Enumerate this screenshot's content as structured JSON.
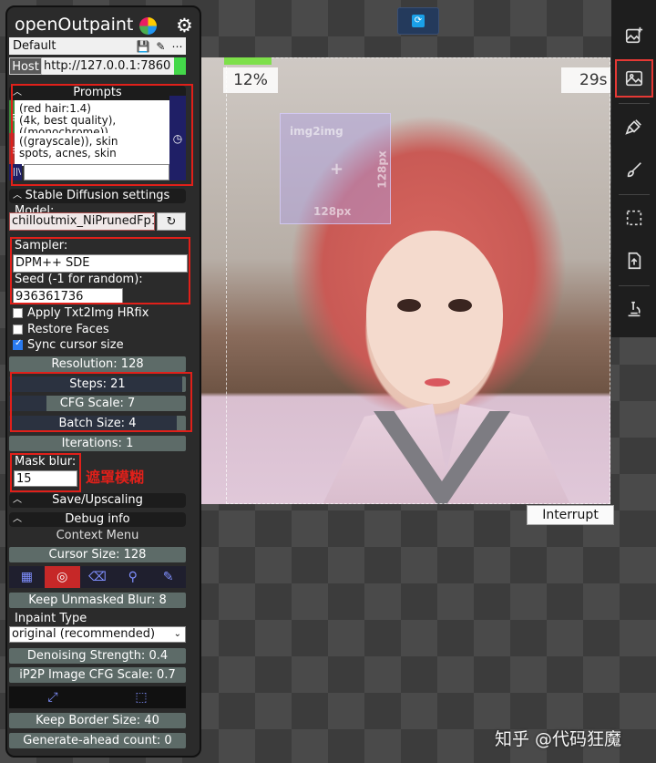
{
  "app": {
    "title": "openOutpaint"
  },
  "canvas": {
    "progress_percent": "12%",
    "elapsed": "29s",
    "selection": {
      "label_top": "img2img",
      "label_bottom": "128px",
      "label_side": "128px"
    },
    "interrupt_label": "Interrupt"
  },
  "preset": {
    "value": "Default"
  },
  "host": {
    "label": "Host",
    "value": "http://127.0.0.1:7860"
  },
  "prompts": {
    "header": "Prompts",
    "positive_lines": "(red hair:1.4)\n(4k, best quality),\n((monochrome)),",
    "negative_lines": "((grayscale)), skin\nspots, acnes, skin",
    "style_value": ""
  },
  "sd_settings": {
    "header": "Stable Diffusion settings",
    "model_label": "Model:",
    "model_value": "chilloutmix_NiPrunedFp1",
    "sampler_label": "Sampler:",
    "sampler_value": "DPM++ SDE",
    "seed_label": "Seed (-1 for random):",
    "seed_value": "936361736",
    "hrfix_label": "Apply Txt2Img HRfix",
    "hrfix_checked": false,
    "restore_faces_label": "Restore Faces",
    "restore_faces_checked": false,
    "sync_cursor_label": "Sync cursor size",
    "sync_cursor_checked": true,
    "resolution": "Resolution: 128",
    "steps": "Steps: 21",
    "cfg_scale": "CFG Scale: 7",
    "batch_size": "Batch Size: 4",
    "iterations": "Iterations: 1",
    "mask_blur_label": "Mask blur:",
    "mask_blur_value": "15",
    "mask_blur_note": "遮罩模糊"
  },
  "sections": {
    "save_upscaling": "Save/Upscaling",
    "debug_info": "Debug info",
    "context_menu": "Context Menu"
  },
  "context": {
    "cursor_size": "Cursor Size: 128",
    "keep_unmasked_blur": "Keep Unmasked Blur: 8",
    "inpaint_type_label": "Inpaint Type",
    "inpaint_type_value": "original (recommended)",
    "denoising_strength": "Denoising Strength: 0.4",
    "ip2p_cfg_scale": "iP2P Image CFG Scale: 0.7",
    "keep_border_size": "Keep Border Size: 40",
    "generate_ahead": "Generate-ahead count: 0"
  },
  "sliders": {
    "steps_fill": 0.98,
    "cfg_fill": 0.21,
    "batch_fill": 0.95
  },
  "watermark": "知乎 @代码狂魔",
  "colors": {
    "panel_bg": "#2b2b2b",
    "highlight_red": "#e0201a",
    "host_ok": "#44d84a",
    "progress_green": "#7ee04a"
  }
}
